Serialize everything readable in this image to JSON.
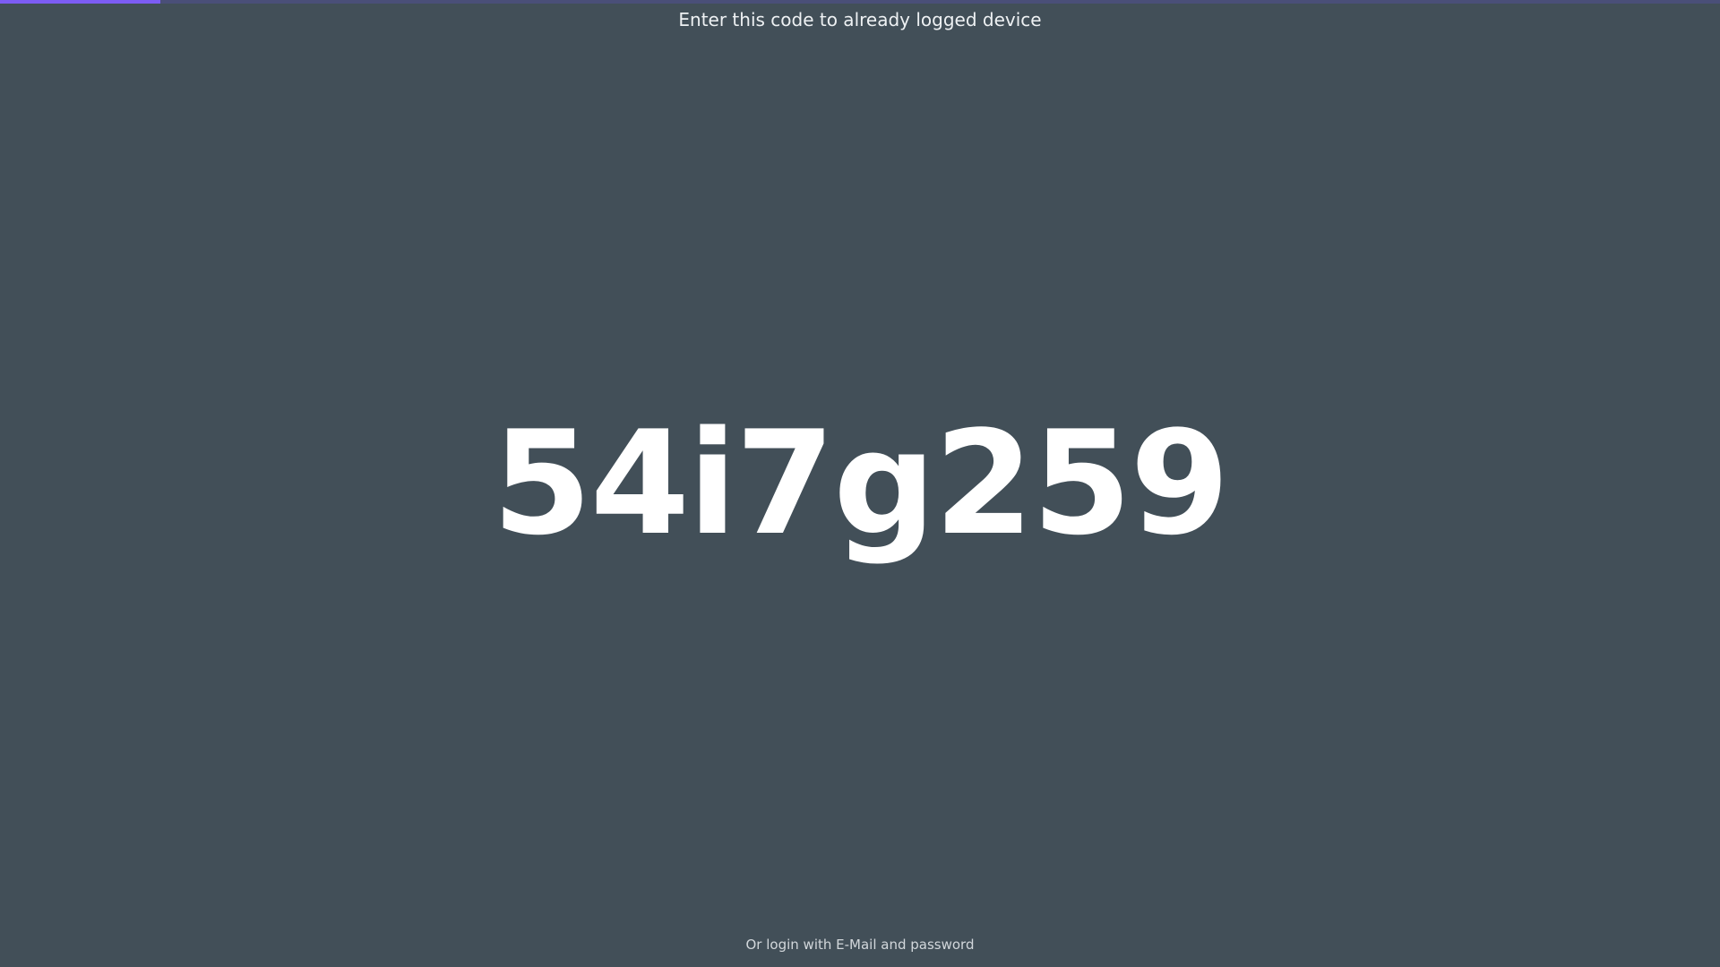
{
  "progress": {
    "fraction": 0.093,
    "fill_color": "#7c5cf4",
    "track_color": "#4a4f78"
  },
  "header": {
    "text": "Enter this code to already logged device"
  },
  "code": {
    "value": "54i7g259"
  },
  "footer": {
    "alt_login_label": "Or login with E-Mail and password"
  },
  "colors": {
    "background": "#424f58"
  }
}
